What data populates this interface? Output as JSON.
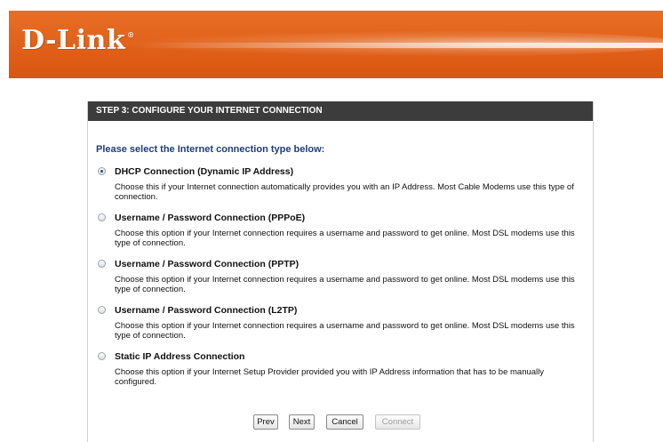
{
  "brand": {
    "logo_text": "D-Link",
    "registered_mark": "®"
  },
  "step_header": "STEP 3: CONFIGURE YOUR INTERNET CONNECTION",
  "prompt": "Please select the Internet connection type below:",
  "options": [
    {
      "title": "DHCP Connection (Dynamic IP Address)",
      "description": "Choose this if your Internet connection automatically provides you with an IP Address. Most Cable Modems use this type of connection.",
      "selected": true
    },
    {
      "title": "Username / Password Connection (PPPoE)",
      "description": "Choose this option if your Internet connection requires a username and password to get online. Most DSL modems use this type of connection.",
      "selected": false
    },
    {
      "title": "Username / Password Connection (PPTP)",
      "description": "Choose this option if your Internet connection requires a username and password to get online. Most DSL modems use this type of connection.",
      "selected": false
    },
    {
      "title": "Username / Password Connection (L2TP)",
      "description": "Choose this option if your Internet connection requires a username and password to get online. Most DSL modems use this type of connection.",
      "selected": false
    },
    {
      "title": "Static IP Address Connection",
      "description": "Choose this option if your Internet Setup Provider provided you with IP Address information that has to be manually configured.",
      "selected": false
    }
  ],
  "buttons": {
    "prev": "Prev",
    "next": "Next",
    "cancel": "Cancel",
    "connect": "Connect"
  },
  "colors": {
    "banner_orange": "#e05f18",
    "header_bg": "#3c3c3c",
    "prompt_blue": "#1f3d7a"
  }
}
